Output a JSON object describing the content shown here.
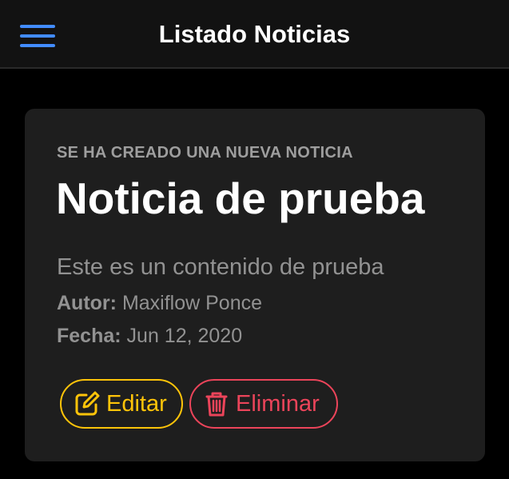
{
  "header": {
    "title": "Listado Noticias",
    "menu_icon": "hamburger-menu-icon",
    "accent_color": "#428cff"
  },
  "card": {
    "subtitle": "SE HA CREADO UNA NUEVA NOTICIA",
    "title": "Noticia de prueba",
    "content": "Este es un contenido de prueba",
    "author_label": "Autor:",
    "author_value": "Maxiflow Ponce",
    "date_label": "Fecha:",
    "date_value": "Jun 12, 2020"
  },
  "actions": {
    "edit_label": "Editar",
    "edit_icon": "edit-icon",
    "edit_color": "#ffc409",
    "delete_label": "Eliminar",
    "delete_icon": "trash-icon",
    "delete_color": "#eb445a"
  }
}
